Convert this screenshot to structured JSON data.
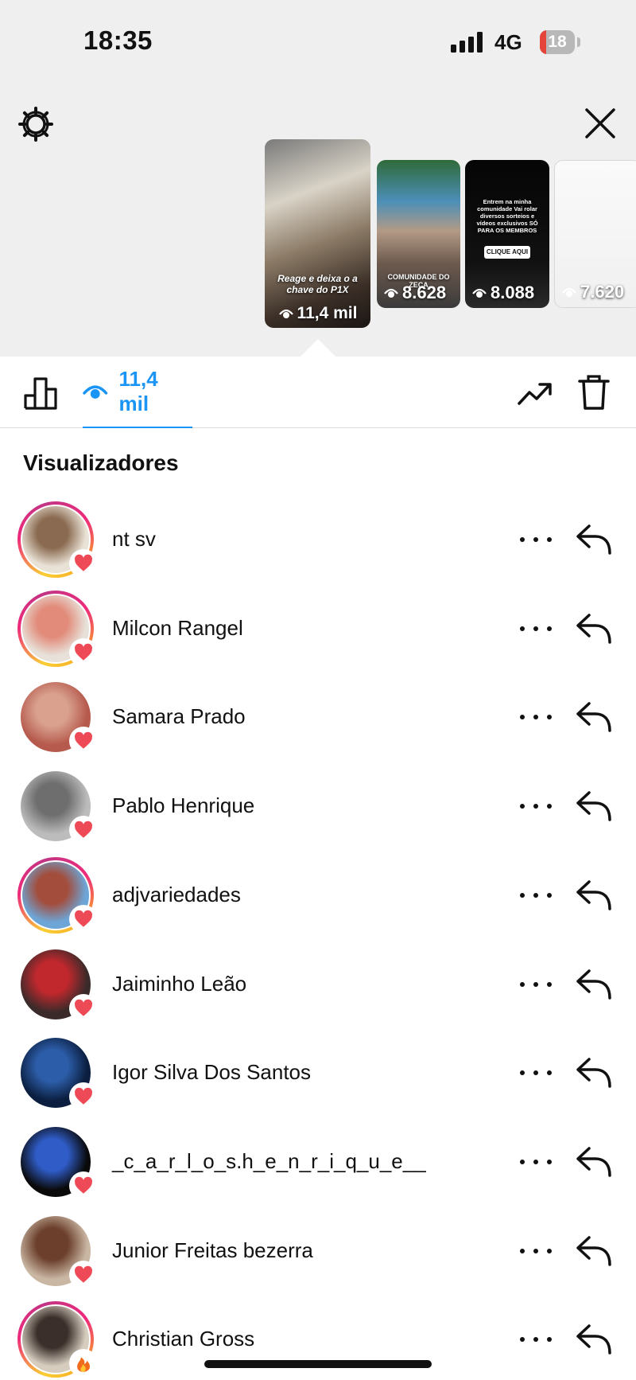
{
  "status_bar": {
    "time": "18:35",
    "network": "4G",
    "battery": "18",
    "battery_level": 0.18
  },
  "stories": [
    {
      "views": "11,4 mil",
      "caption": "Reage e deixa o a chave do P1X"
    },
    {
      "views": "8.628",
      "caption": "COMUNIDADE DO ZECA"
    },
    {
      "views": "8.088",
      "caption": "Entrem na minha comunidade Vai rolar diversos sorteios e vídeos exclusivos SÓ PARA OS MEMBROS",
      "button": "CLIQUE AQUI"
    },
    {
      "views": "7.620"
    }
  ],
  "tabs": {
    "views_count": "11,4 mil"
  },
  "section_title": "Visualizadores",
  "colors": {
    "accent": "#1b95f5",
    "like": "#ed4956",
    "background_top": "#efefef"
  },
  "viewers": [
    {
      "name": "nt sv",
      "story_ring": true,
      "reaction": "heart",
      "avatar_colors": [
        "#e9e2d6",
        "#8a6a50"
      ]
    },
    {
      "name": "Milcon Rangel",
      "story_ring": true,
      "reaction": "heart",
      "avatar_colors": [
        "#e7e1d9",
        "#e28b7a"
      ]
    },
    {
      "name": "Samara Prado",
      "story_ring": false,
      "reaction": "heart",
      "avatar_colors": [
        "#b65a4d",
        "#d9a18e"
      ]
    },
    {
      "name": "Pablo Henrique",
      "story_ring": false,
      "reaction": "heart",
      "avatar_colors": [
        "#bcbcbc",
        "#6e6e6e"
      ]
    },
    {
      "name": "adjvariedades",
      "story_ring": true,
      "reaction": "heart",
      "avatar_colors": [
        "#6da5d6",
        "#a34d3c"
      ]
    },
    {
      "name": "Jaiminho Leão",
      "story_ring": false,
      "reaction": "heart",
      "avatar_colors": [
        "#3a2a2a",
        "#c0282d"
      ]
    },
    {
      "name": "Igor Silva Dos Santos",
      "story_ring": false,
      "reaction": "heart",
      "avatar_colors": [
        "#0b1e3f",
        "#2c5da8"
      ]
    },
    {
      "name": "_c_a_r_l_o_s.h_e_n_r_i_q_u_e__",
      "story_ring": false,
      "reaction": "heart",
      "avatar_colors": [
        "#0a0a0a",
        "#2f5cc7"
      ]
    },
    {
      "name": "Junior Freitas bezerra",
      "story_ring": false,
      "reaction": "heart",
      "avatar_colors": [
        "#c9b6a3",
        "#6b3f2b"
      ]
    },
    {
      "name": "Christian Gross",
      "story_ring": true,
      "reaction": "fire",
      "avatar_colors": [
        "#d6cdbf",
        "#3a2f2a"
      ]
    }
  ]
}
